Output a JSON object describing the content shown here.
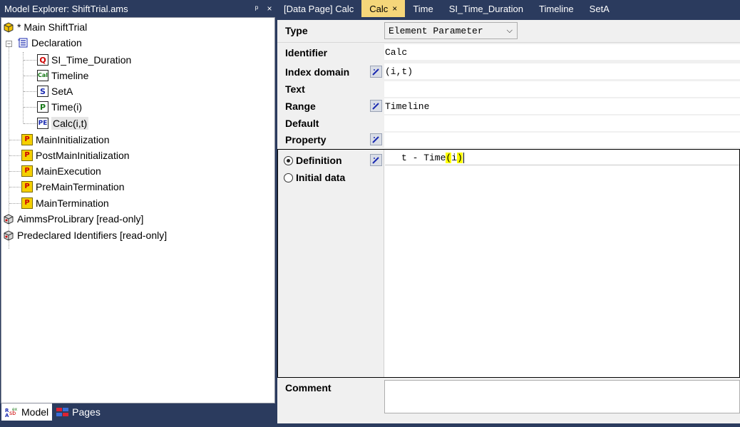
{
  "explorer": {
    "title": "Model Explorer: ShiftTrial.ams",
    "pin_glyph": "ᴟ",
    "close_glyph": "×",
    "tree": [
      {
        "label": "* Main ShiftTrial",
        "icon": "model-box-icon"
      },
      {
        "label": "Declaration",
        "icon": "declaration-icon"
      },
      {
        "label": "SI_Time_Duration",
        "icon": "quantity-icon",
        "badge": "Q"
      },
      {
        "label": "Timeline",
        "icon": "calendar-icon",
        "badge": "Cal"
      },
      {
        "label": "SetA",
        "icon": "set-icon",
        "badge": "S"
      },
      {
        "label": "Time(i)",
        "icon": "parameter-icon",
        "badge": "P"
      },
      {
        "label": "Calc(i,t)",
        "icon": "element-parameter-icon",
        "badge": "PE"
      },
      {
        "label": "MainInitialization",
        "icon": "procedure-icon",
        "badge": "P"
      },
      {
        "label": "PostMainInitialization",
        "icon": "procedure-icon",
        "badge": "P"
      },
      {
        "label": "MainExecution",
        "icon": "procedure-icon",
        "badge": "P"
      },
      {
        "label": "PreMainTermination",
        "icon": "procedure-icon",
        "badge": "P"
      },
      {
        "label": "MainTermination",
        "icon": "procedure-icon",
        "badge": "P"
      },
      {
        "label": "AimmsProLibrary [read-only]",
        "icon": "library-icon"
      },
      {
        "label": "Predeclared Identifiers [read-only]",
        "icon": "library-icon"
      }
    ],
    "tabs": [
      {
        "label": "Model",
        "active": true
      },
      {
        "label": "Pages",
        "active": false
      }
    ]
  },
  "doc_tabs": [
    {
      "label": "[Data Page] Calc",
      "active": false
    },
    {
      "label": "Calc",
      "active": true,
      "close": "×"
    },
    {
      "label": "Time",
      "active": false
    },
    {
      "label": "SI_Time_Duration",
      "active": false
    },
    {
      "label": "Timeline",
      "active": false
    },
    {
      "label": "SetA",
      "active": false
    }
  ],
  "attributes": {
    "type_label": "Type",
    "type_value": "Element Parameter",
    "identifier_label": "Identifier",
    "identifier_value": "Calc",
    "index_domain_label": "Index domain",
    "index_domain_value": "(i,t)",
    "text_label": "Text",
    "text_value": "",
    "range_label": "Range",
    "range_value": "Timeline",
    "default_label": "Default",
    "default_value": "",
    "property_label": "Property",
    "property_value": ""
  },
  "definition": {
    "definition_label": "Definition",
    "initial_data_label": "Initial data",
    "selected": "Definition",
    "code_prefix": "t - Time",
    "code_open": "(",
    "code_index": "i",
    "code_close": ")"
  },
  "comment": {
    "label": "Comment",
    "value": ""
  },
  "colors": {
    "chrome": "#2b3b5e",
    "active_tab": "#f5d67a",
    "paren_highlight": "#ffff00"
  }
}
